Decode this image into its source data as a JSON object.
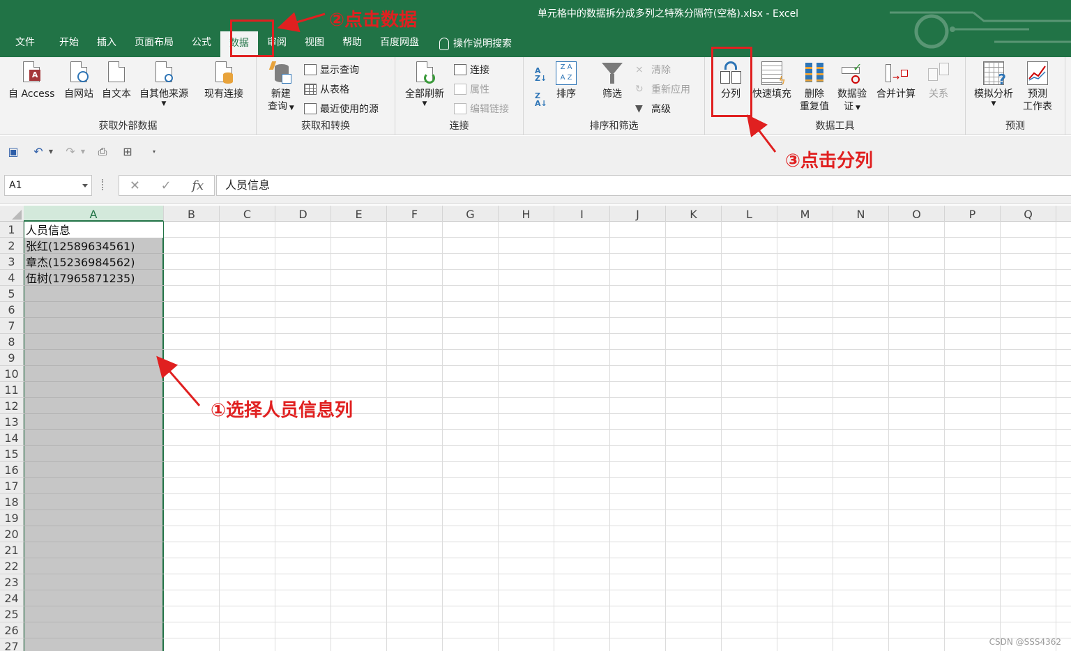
{
  "window": {
    "title": "单元格中的数据拆分成多列之特殊分隔符(空格).xlsx  -  Excel"
  },
  "tabs": [
    "文件",
    "开始",
    "插入",
    "页面布局",
    "公式",
    "数据",
    "审阅",
    "视图",
    "帮助",
    "百度网盘"
  ],
  "search_tab": "操作说明搜索",
  "ribbon": {
    "get_external": {
      "label": "获取外部数据",
      "buttons": [
        "自 Access",
        "自网站",
        "自文本",
        "自其他来源",
        "现有连接"
      ]
    },
    "get_transform": {
      "label": "获取和转换",
      "new_query_line1": "新建",
      "new_query_line2": "查询",
      "small": [
        "显示查询",
        "从表格",
        "最近使用的源"
      ]
    },
    "connections": {
      "label": "连接",
      "refresh_all": "全部刷新",
      "small": [
        "连接",
        "属性",
        "编辑链接"
      ]
    },
    "sort_filter": {
      "label": "排序和筛选",
      "sort": "排序",
      "filter": "筛选",
      "small": [
        "清除",
        "重新应用",
        "高级"
      ]
    },
    "data_tools": {
      "label": "数据工具",
      "text_to_columns": "分列",
      "flash_fill": "快速填充",
      "remove_dup_line1": "删除",
      "remove_dup_line2": "重复值",
      "validation_line1": "数据验",
      "validation_line2": "证",
      "consolidate": "合并计算",
      "relationships": "关系"
    },
    "forecast": {
      "label": "预测",
      "what_if": "模拟分析",
      "sheet_line1": "预测",
      "sheet_line2": "工作表"
    }
  },
  "formula_bar": {
    "name_box": "A1",
    "fx": "fx",
    "cancel": "✕",
    "enter": "✓",
    "content": "人员信息"
  },
  "columns": [
    "A",
    "B",
    "C",
    "D",
    "E",
    "F",
    "G",
    "H",
    "I",
    "J",
    "K",
    "L",
    "M",
    "N",
    "O",
    "P",
    "Q"
  ],
  "rows": [
    "1",
    "2",
    "3",
    "4",
    "5",
    "6",
    "7",
    "8",
    "9",
    "10",
    "11",
    "12",
    "13",
    "14",
    "15",
    "16",
    "17",
    "18",
    "19",
    "20",
    "21",
    "22",
    "23",
    "24",
    "25",
    "26",
    "27"
  ],
  "cells": {
    "A1": "人员信息",
    "A2": "张红(12589634561)",
    "A3": "章杰(15236984562)",
    "A4": "伍树(17965871235)"
  },
  "annotations": {
    "step1": "①选择人员信息列",
    "step2": "②点击数据",
    "step3": "③点击分列"
  },
  "watermark": "CSDN @SSS4362",
  "colors": {
    "excel_green": "#217346",
    "annotation_red": "#e02020",
    "selection_gray": "#c6c6c6"
  }
}
